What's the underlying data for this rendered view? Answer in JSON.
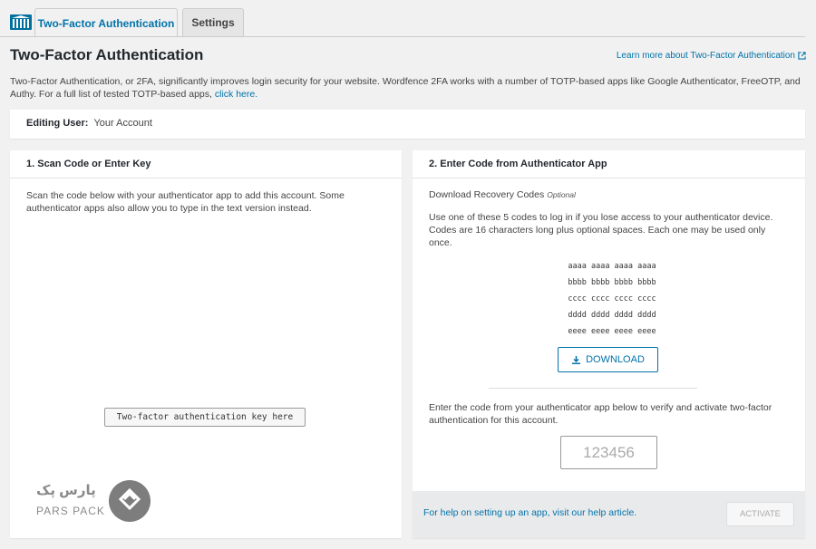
{
  "tabs": [
    {
      "label": "Two-Factor Authentication",
      "active": true
    },
    {
      "label": "Settings",
      "active": false
    }
  ],
  "page": {
    "title": "Two-Factor Authentication",
    "learn_more": "Learn more about Two-Factor Authentication",
    "intro": "Two-Factor Authentication, or 2FA, significantly improves login security for your website. Wordfence 2FA works with a number of TOTP-based apps like Google Authenticator, FreeOTP, and Authy. For a full list of tested TOTP-based apps, ",
    "intro_link": "click here."
  },
  "editing": {
    "label": "Editing User:",
    "value": "Your Account"
  },
  "scan": {
    "heading": "1. Scan Code or Enter Key",
    "text": "Scan the code below with your authenticator app to add this account. Some authenticator apps also allow you to type in the text version instead.",
    "key_text": "Two-factor authentication key here"
  },
  "enter": {
    "heading": "2. Enter Code from Authenticator App",
    "recovery_title": "Download Recovery Codes",
    "recovery_optional": "Optional",
    "recovery_desc": "Use one of these 5 codes to log in if you lose access to your authenticator device. Codes are 16 characters long plus optional spaces. Each one may be used only once.",
    "codes": [
      "aaaa aaaa aaaa aaaa",
      "bbbb bbbb bbbb bbbb",
      "cccc cccc cccc cccc",
      "dddd dddd dddd dddd",
      "eeee eeee eeee eeee"
    ],
    "download_label": "DOWNLOAD",
    "verify_text": "Enter the code from your authenticator app below to verify and activate two-factor authentication for this account.",
    "code_placeholder": "123456",
    "help_text": "For help on setting up an app, visit our help article.",
    "activate_label": "ACTIVATE"
  },
  "watermark": {
    "fa": "پارس پک",
    "en": "PARS PACK"
  },
  "colors": {
    "link": "#0073aa",
    "background": "#f1f1f1"
  },
  "icons": {
    "logo": "wordfence-logo-icon",
    "external": "external-link-icon",
    "download": "download-icon"
  }
}
